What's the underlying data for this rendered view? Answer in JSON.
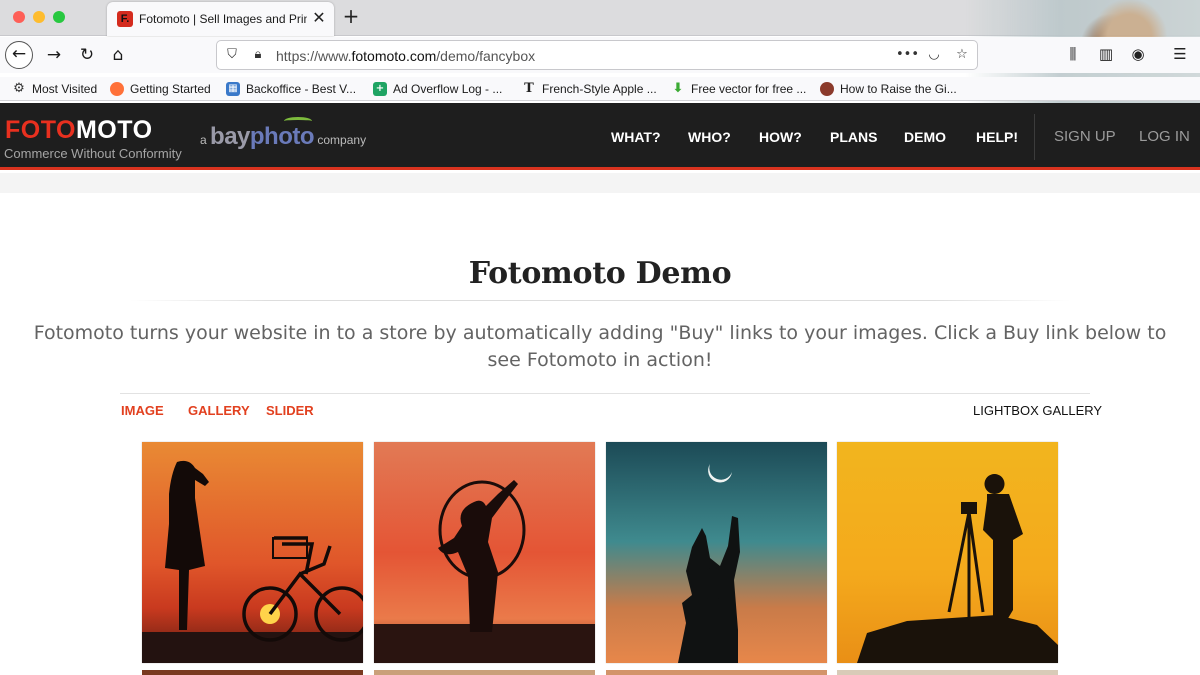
{
  "browser": {
    "tab": {
      "favicon": "F.",
      "title": "Fotomoto | Sell Images and Prints"
    },
    "url": {
      "prefix": "https://www.",
      "domain": "fotomoto.com",
      "path": "/demo/fancybox"
    },
    "bookmarks": [
      {
        "label": "Most Visited",
        "icon": "gear-icon"
      },
      {
        "label": "Getting Started",
        "icon": "firefox-icon"
      },
      {
        "label": "Backoffice - Best V...",
        "icon": "backoffice-icon"
      },
      {
        "label": "Ad Overflow Log - ...",
        "icon": "sheets-icon"
      },
      {
        "label": "French-Style Apple ...",
        "icon": "t-icon"
      },
      {
        "label": "Free vector for free ...",
        "icon": "download-arrow-icon"
      },
      {
        "label": "How to Raise the Gi...",
        "icon": "ladybug-icon"
      }
    ]
  },
  "site": {
    "logo": {
      "part1": "FOTO",
      "part2": "MOTO"
    },
    "tagline": "Commerce Without Conformity",
    "partner": {
      "a": "a",
      "bay": "bay",
      "photo": "photo",
      "company": "company"
    },
    "menu": [
      "WHAT?",
      "WHO?",
      "HOW?",
      "PLANS",
      "DEMO",
      "HELP!"
    ],
    "account": {
      "signup": "SIGN UP",
      "login": "LOG IN"
    },
    "accent_color": "#d9331f"
  },
  "main": {
    "title": "Fotomoto Demo",
    "description": "Fotomoto turns your website in to a store by automatically adding \"Buy\" links to your images. Click a Buy link below to see Fotomoto in action!",
    "tabs": [
      "IMAGE",
      "GALLERY",
      "SLIDER"
    ],
    "gallery_label": "LIGHTBOX GALLERY"
  }
}
